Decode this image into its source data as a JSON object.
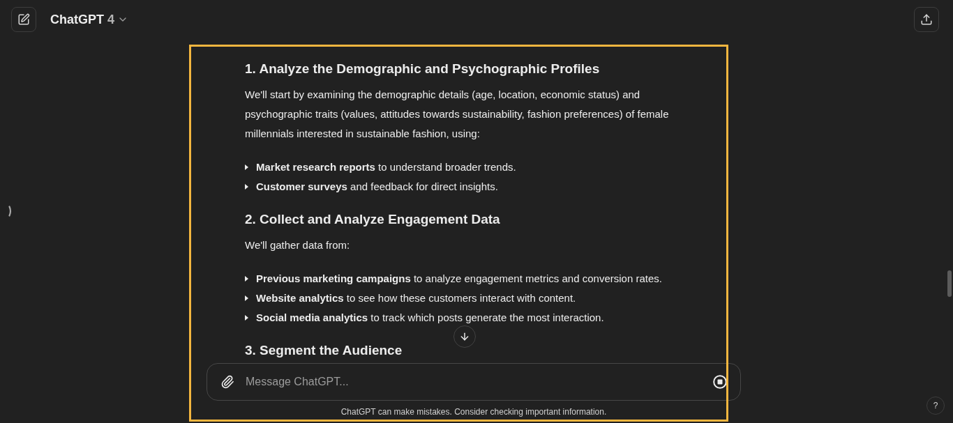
{
  "header": {
    "title": "ChatGPT",
    "model": "4"
  },
  "message": {
    "sections": [
      {
        "heading": "1. Analyze the Demographic and Psychographic Profiles",
        "intro": "We'll start by examining the demographic details (age, location, economic status) and psychographic traits (values, attitudes towards sustainability, fashion preferences) of female millennials interested in sustainable fashion, using:",
        "bullets": [
          "**Market research reports** to understand broader trends.",
          "**Customer surveys** and feedback for direct insights."
        ]
      },
      {
        "heading": "2. Collect and Analyze Engagement Data",
        "intro": "We'll gather data from:",
        "bullets": [
          "**Previous marketing campaigns** to analyze engagement metrics and conversion rates.",
          "**Website analytics** to see how these customers interact with content.",
          "**Social media analytics** to track which posts generate the most interaction."
        ]
      },
      {
        "heading": "3. Segment the Audience"
      }
    ]
  },
  "composer": {
    "placeholder": "Message ChatGPT..."
  },
  "disclaimer": "ChatGPT can make mistakes. Consider checking important information.",
  "help_button": "?"
}
